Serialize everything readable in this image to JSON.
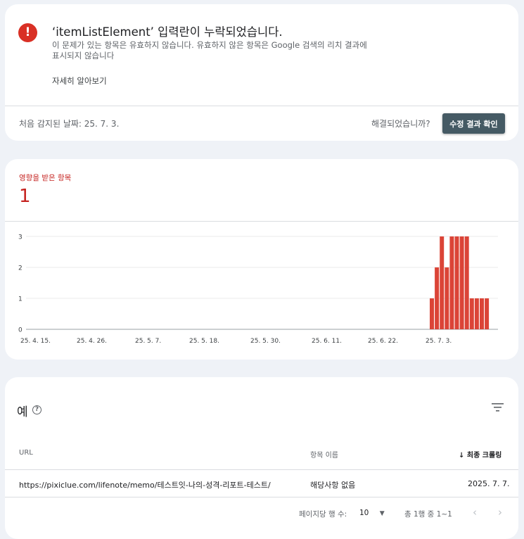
{
  "issue": {
    "icon": "error-icon",
    "title": "‘itemListElement’ 입력란이 누락되었습니다.",
    "description": "이 문제가 있는 항목은 유효하지 않습니다. 유효하지 않은 항목은 Google 검색의 리치 결과에 표시되지 않습니다",
    "learn_more": "자세히 알아보기",
    "first_detected": "처음 감지된 날짜: 25. 7. 3.",
    "resolved_question": "해결되었습니까?",
    "validate_button": "수정 결과 확인"
  },
  "affected": {
    "label": "영향을 받은 항목",
    "value": "1"
  },
  "chart_data": {
    "type": "bar",
    "color": "#db4437",
    "y_ticks": [
      "0",
      "1",
      "2",
      "3"
    ],
    "ylim": [
      0,
      3
    ],
    "x_tick_labels": [
      "25. 4. 15.",
      "25. 4. 26.",
      "25. 5. 7.",
      "25. 5. 18.",
      "25. 5. 30.",
      "25. 6. 11.",
      "25. 6. 22.",
      "25. 7. 3."
    ],
    "categories": [
      "25. 7. 1.",
      "25. 7. 2.",
      "25. 7. 3.",
      "25. 7. 4.",
      "25. 7. 5.",
      "25. 7. 6.",
      "25. 7. 7.",
      "25. 7. 8.",
      "25. 7. 9.",
      "25. 7. 10.",
      "25. 7. 11.",
      "25. 7. 12."
    ],
    "values": [
      1,
      2,
      3,
      2,
      3,
      3,
      3,
      3,
      1,
      1,
      1,
      1
    ]
  },
  "examples": {
    "title": "예",
    "help_icon": "help-circle-icon",
    "filter_icon": "filter-icon",
    "columns": {
      "url": "URL",
      "item_name": "항목 이름",
      "last_crawled": "최종 크롤링"
    },
    "sort_icon": "arrow-down-icon",
    "rows": [
      {
        "url": "https://pixiclue.com/lifenote/memo/테스트잇-나의-성격-리포트-테스트/",
        "item_name": "해당사항 없음",
        "last_crawled": "2025. 7. 7."
      }
    ],
    "pagination": {
      "rows_per_page_label": "페이지당 행 수:",
      "rows_per_page_value": "10",
      "range_text": "총 1행 중 1~1"
    }
  }
}
